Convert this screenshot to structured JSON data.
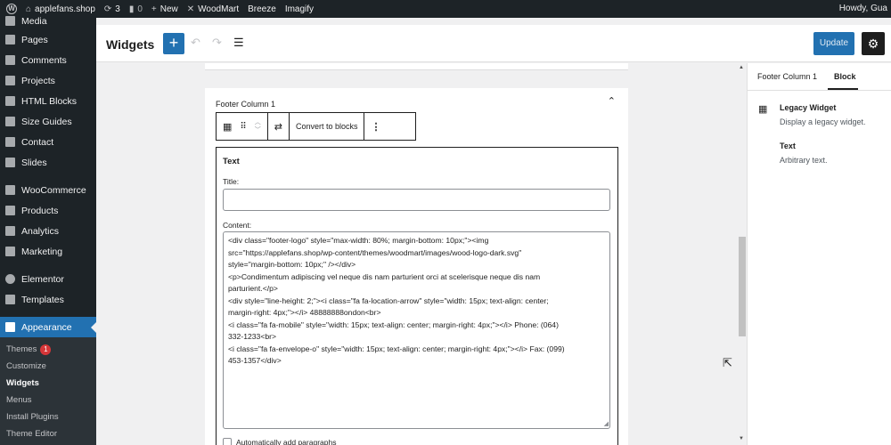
{
  "admin_bar": {
    "site_name": "applefans.shop",
    "updates_count": "3",
    "comments_count": "0",
    "new_label": "New",
    "woodmart_label": "WoodMart",
    "breeze_label": "Breeze",
    "imagify_label": "Imagify",
    "howdy_text": "Howdy, Gua"
  },
  "sidebar": {
    "items": [
      {
        "label": "Media",
        "icon": "media-icon"
      },
      {
        "label": "Pages",
        "icon": "pages-icon"
      },
      {
        "label": "Comments",
        "icon": "comments-icon"
      },
      {
        "label": "Projects",
        "icon": "projects-icon"
      },
      {
        "label": "HTML Blocks",
        "icon": "html-blocks-icon"
      },
      {
        "label": "Size Guides",
        "icon": "size-guides-icon"
      },
      {
        "label": "Contact",
        "icon": "contact-icon"
      },
      {
        "label": "Slides",
        "icon": "slides-icon"
      },
      {
        "label": "WooCommerce",
        "icon": "woocommerce-icon"
      },
      {
        "label": "Products",
        "icon": "products-icon"
      },
      {
        "label": "Analytics",
        "icon": "analytics-icon"
      },
      {
        "label": "Marketing",
        "icon": "marketing-icon"
      },
      {
        "label": "Elementor",
        "icon": "elementor-icon"
      },
      {
        "label": "Templates",
        "icon": "templates-icon"
      },
      {
        "label": "Appearance",
        "icon": "appearance-icon"
      }
    ],
    "submenu": [
      {
        "label": "Themes",
        "badge": "1"
      },
      {
        "label": "Customize"
      },
      {
        "label": "Widgets"
      },
      {
        "label": "Menus"
      },
      {
        "label": "Install Plugins"
      },
      {
        "label": "Theme Editor"
      }
    ]
  },
  "header": {
    "title": "Widgets",
    "add_label": "+",
    "update_label": "Update"
  },
  "widget_area": {
    "title": "Footer Column 1",
    "toolbar": {
      "convert_label": "Convert to blocks"
    },
    "legacy_widget": {
      "heading": "Text",
      "title_label": "Title:",
      "title_value": "",
      "content_label": "Content:",
      "content_lines": [
        "<div class=\"footer-logo\" style=\"max-width: 80%; margin-bottom: 10px;\"><img",
        "src=\"https://applefans.shop/wp-content/themes/woodmart/images/wood-logo-dark.svg\"",
        "style=\"margin-bottom: 10px;\" /></div>",
        "<p>Condimentum adipiscing vel neque dis nam parturient orci at scelerisque neque dis nam",
        "parturient.</p>",
        "<div style=\"line-height: 2;\"><i class=\"fa fa-location-arrow\" style=\"width: 15px; text-align: center;",
        "margin-right: 4px;\"></i> 48888888ondon<br>",
        "<i class=\"fa fa-mobile\" style=\"width: 15px; text-align: center; margin-right: 4px;\"></i> Phone: (064)",
        "332-1233<br>",
        "<i class=\"fa fa-envelope-o\" style=\"width: 15px; text-align: center; margin-right: 4px;\"></i> Fax: (099)",
        "453-1357</div>"
      ],
      "auto_paragraphs_label": "Automatically add paragraphs"
    }
  },
  "panel": {
    "tabs": [
      "Footer Column 1",
      "Block"
    ],
    "active_tab": "Block",
    "block_title": "Legacy Widget",
    "block_desc": "Display a legacy widget.",
    "widget_title": "Text",
    "widget_desc": "Arbitrary text."
  },
  "colors": {
    "admin_dark": "#1d2327",
    "accent": "#2271b1",
    "badge": "#d63638"
  }
}
